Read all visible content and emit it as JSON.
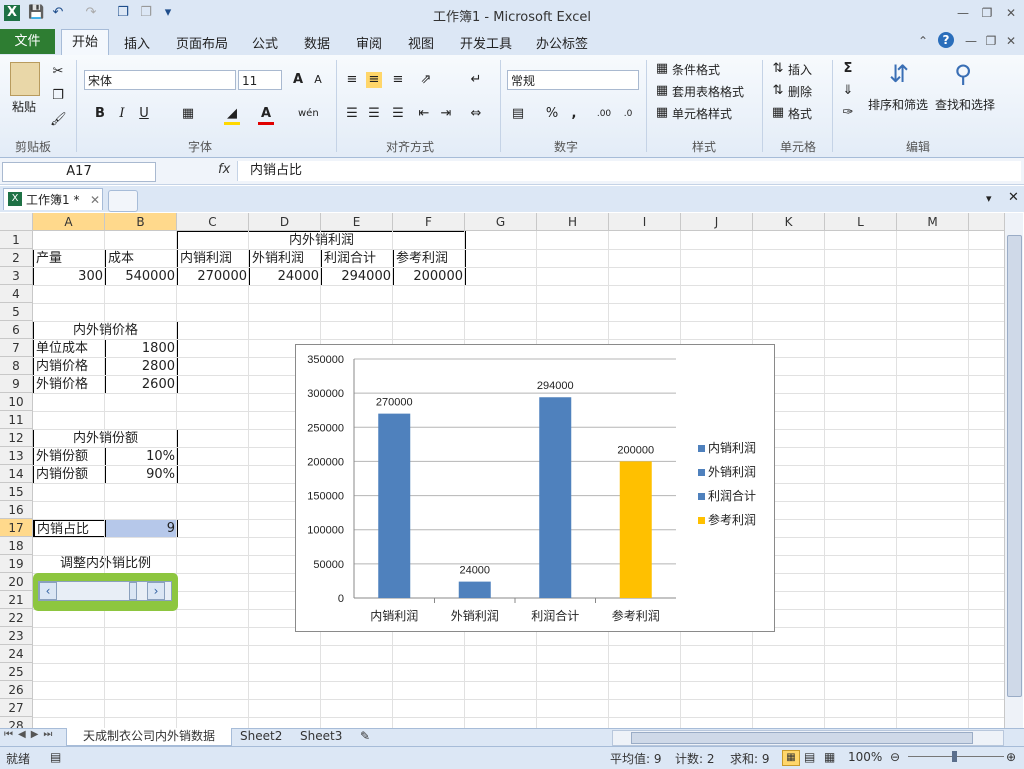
{
  "window": {
    "title": "工作簿1 - Microsoft Excel"
  },
  "ribbon": {
    "file_label": "文件",
    "tabs": [
      "开始",
      "插入",
      "页面布局",
      "公式",
      "数据",
      "审阅",
      "视图",
      "开发工具",
      "办公标签"
    ],
    "groups": {
      "clipboard": "剪贴板",
      "font": "字体",
      "alignment": "对齐方式",
      "number": "数字",
      "styles": "样式",
      "cells": "单元格",
      "editing": "编辑"
    },
    "paste_label": "粘贴",
    "font_name": "宋体",
    "font_size": "11",
    "number_format": "常规",
    "styles_items": [
      "条件格式",
      "套用表格格式",
      "单元格样式"
    ],
    "cells_items": [
      "插入",
      "删除",
      "格式"
    ],
    "sort_filter": "排序和筛选",
    "find_select": "查找和选择",
    "percent_glyph": "%",
    "comma_glyph": ","
  },
  "formula_bar": {
    "name_box": "A17",
    "fx": "fx",
    "content": "内销占比"
  },
  "workbook_tab": {
    "label": "工作簿1 *"
  },
  "columns": [
    "A",
    "B",
    "C",
    "D",
    "E",
    "F",
    "G",
    "H",
    "I",
    "J",
    "K",
    "L",
    "M"
  ],
  "rows": [
    "1",
    "2",
    "3",
    "4",
    "5",
    "6",
    "7",
    "8",
    "9",
    "10",
    "11",
    "12",
    "13",
    "14",
    "15",
    "16",
    "17",
    "18",
    "19",
    "20",
    "21",
    "22",
    "23",
    "24",
    "25",
    "26",
    "27",
    "28"
  ],
  "cells": {
    "r1_title": "内外销利润",
    "r2": [
      "产量",
      "成本",
      "内销利润",
      "外销利润",
      "利润合计",
      "参考利润"
    ],
    "r3": [
      "300",
      "540000",
      "270000",
      "24000",
      "294000",
      "200000"
    ],
    "price_title": "内外销价格",
    "price_rows": [
      [
        "单位成本",
        "1800"
      ],
      [
        "内销价格",
        "2800"
      ],
      [
        "外销价格",
        "2600"
      ]
    ],
    "share_title": "内外销份额",
    "share_rows": [
      [
        "外销份额",
        "10%"
      ],
      [
        "内销份额",
        "90%"
      ]
    ],
    "a17": "内销占比",
    "b17": "9",
    "a19": "调整内外销比例"
  },
  "chart_data": {
    "type": "bar",
    "categories": [
      "内销利润",
      "外销利润",
      "利润合计",
      "参考利润"
    ],
    "values": [
      270000,
      24000,
      294000,
      200000
    ],
    "colors": [
      "#4f81bd",
      "#4f81bd",
      "#4f81bd",
      "#ffc000"
    ],
    "ylim": [
      0,
      350000
    ],
    "yticks": [
      "350000",
      "300000",
      "250000",
      "200000",
      "150000",
      "100000",
      "50000",
      "0"
    ],
    "data_labels": [
      "270000",
      "24000",
      "294000",
      "200000"
    ],
    "legend": [
      "内销利润",
      "外销利润",
      "利润合计",
      "参考利润"
    ],
    "legend_position": "right",
    "grid": true
  },
  "sheets": [
    "天成制衣公司内外销数据",
    "Sheet2",
    "Sheet3"
  ],
  "status": {
    "ready": "就绪",
    "average": "平均值: 9",
    "count": "计数: 2",
    "sum": "求和: 9",
    "zoom": "100%"
  }
}
